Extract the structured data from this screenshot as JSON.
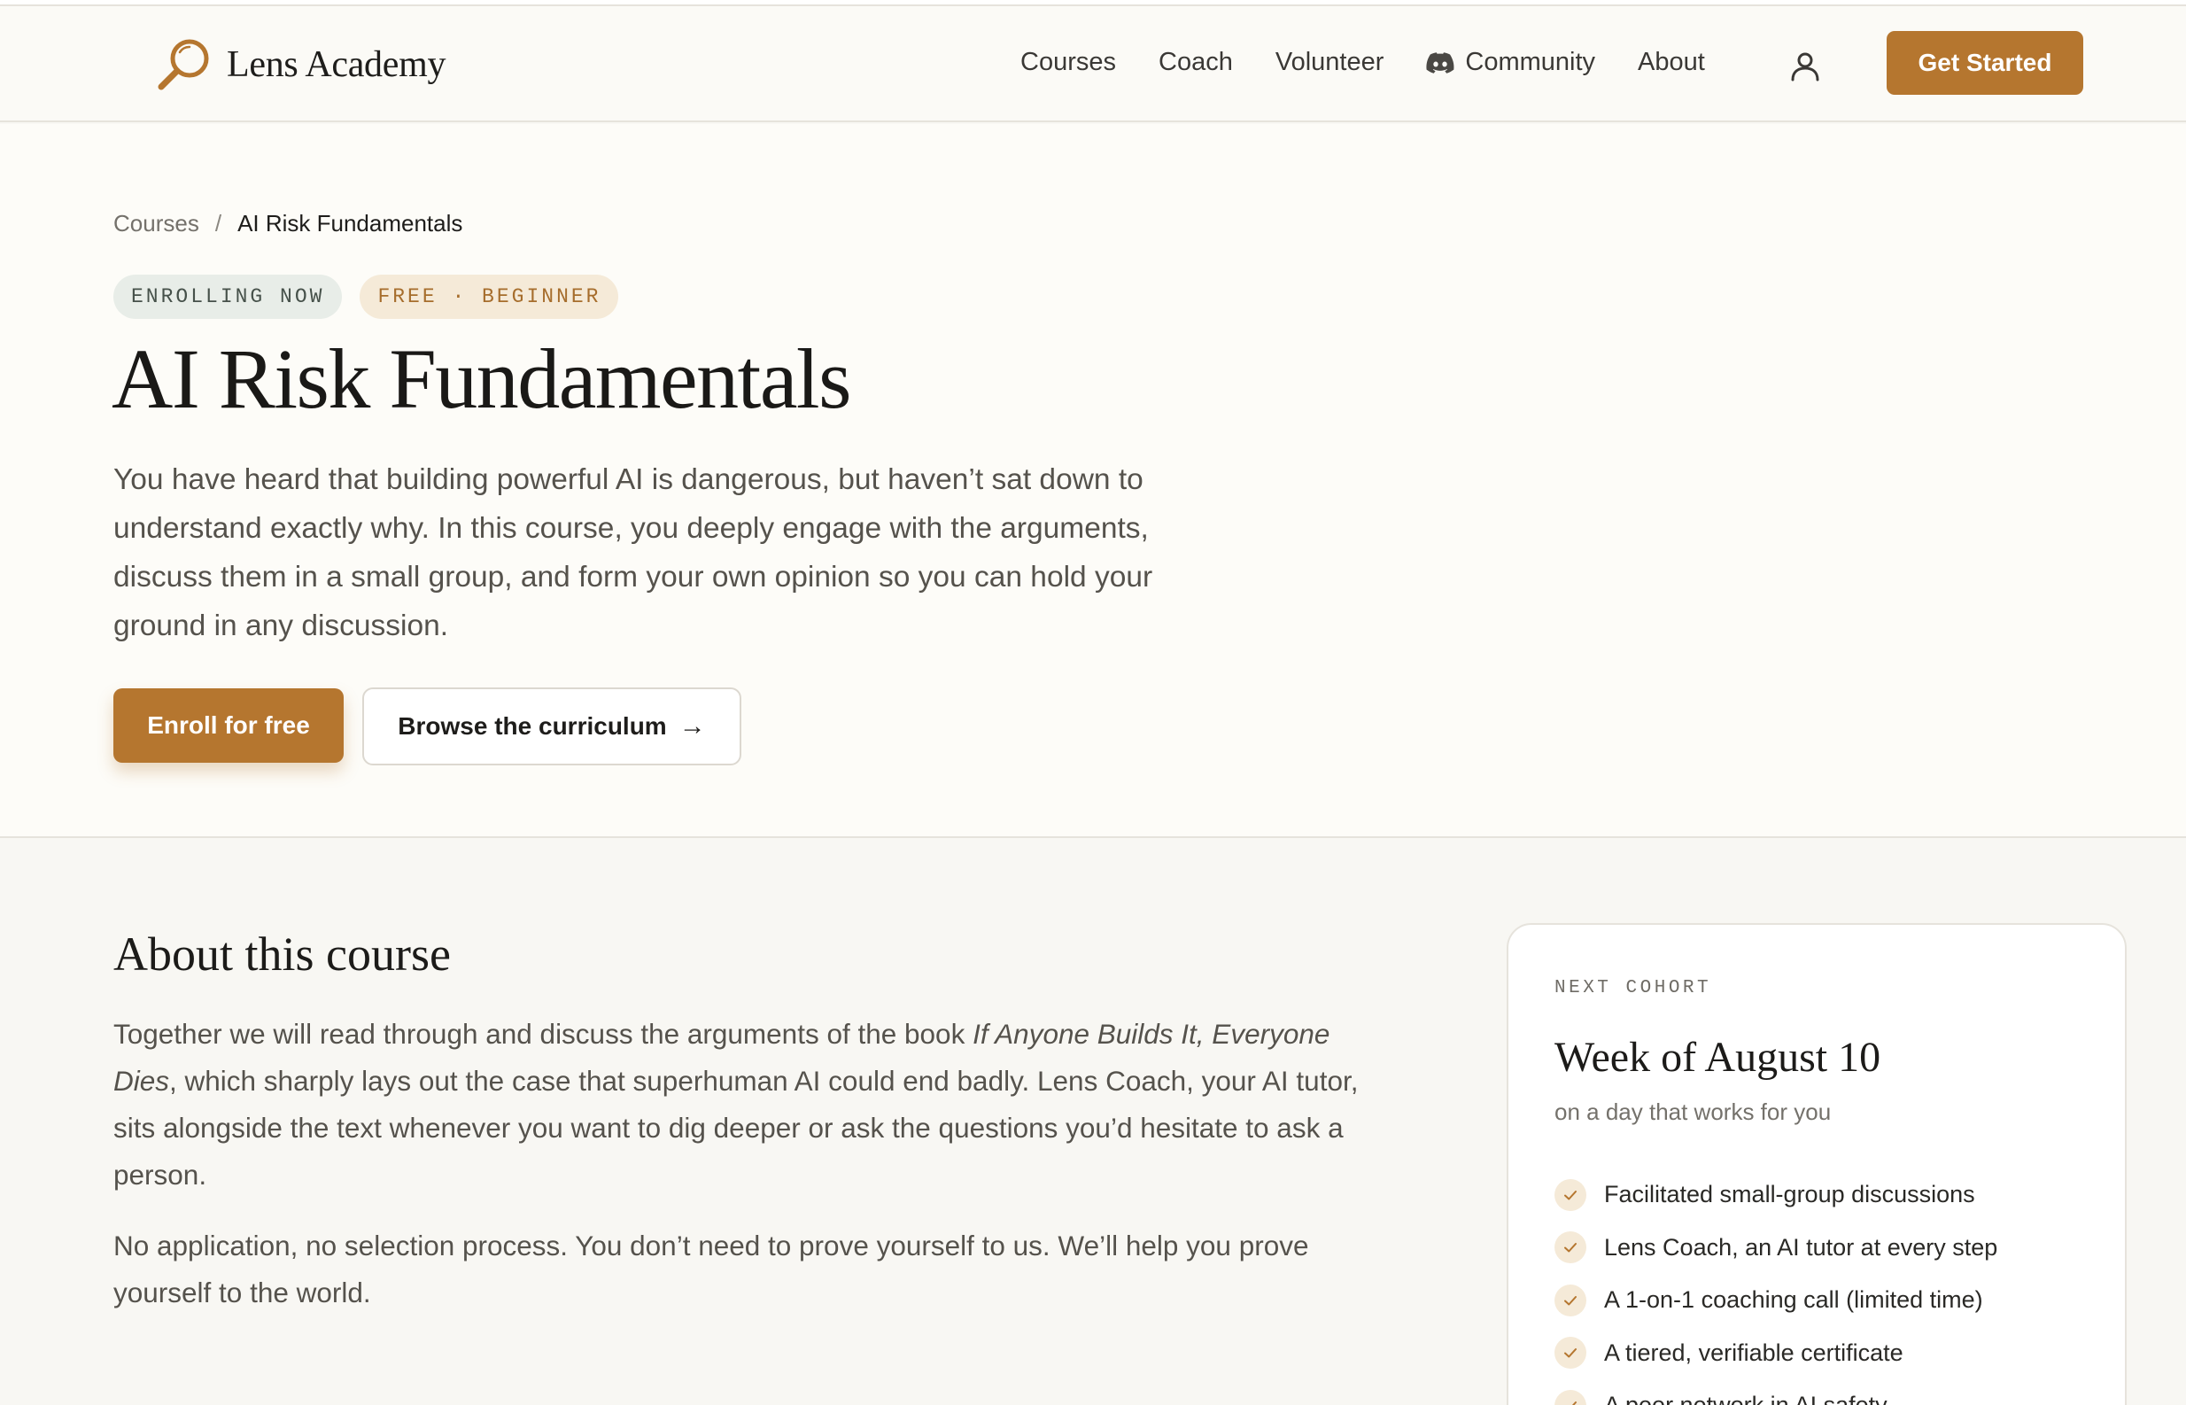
{
  "brand": {
    "name": "Lens Academy",
    "logo_icon": "magnifying-glass-icon",
    "accent_color": "#b5762f"
  },
  "nav": {
    "items": [
      {
        "label": "Courses"
      },
      {
        "label": "Coach"
      },
      {
        "label": "Volunteer"
      },
      {
        "label": "Community",
        "icon": "discord-icon"
      },
      {
        "label": "About"
      }
    ],
    "user_icon": "user-icon",
    "cta_label": "Get Started"
  },
  "breadcrumb": {
    "parent": "Courses",
    "separator": "/",
    "current": "AI Risk Fundamentals"
  },
  "hero": {
    "badges": [
      "ENROLLING NOW",
      "FREE · BEGINNER"
    ],
    "title": "AI Risk Fundamentals",
    "description": "You have heard that building powerful AI is dangerous, but haven’t sat down to understand exactly why. In this course, you deeply engage with the arguments, discuss them in a small group, and form your own opinion so you can hold your ground in any discussion.",
    "primary_button": "Enroll for free",
    "secondary_button": "Browse the curriculum",
    "secondary_button_arrow": "→"
  },
  "about": {
    "title": "About this course",
    "p1_before": "Together we will read through and discuss the arguments of the book ",
    "p1_book": "If Anyone Builds It, Everyone Dies",
    "p1_after": ", which sharply lays out the case that superhuman AI could end badly. Lens Coach, your AI tutor, sits alongside the text whenever you want to dig deeper or ask the questions you’d hesitate to ask a person.",
    "p2": "No application, no selection process. You don’t need to prove yourself to us. We’ll help you prove yourself to the world."
  },
  "cohort": {
    "eyebrow": "NEXT COHORT",
    "title": "Week of August 10",
    "subtitle": "on a day that works for you",
    "features": [
      "Facilitated small-group discussions",
      "Lens Coach, an AI tutor at every step",
      "A 1-on-1 coaching call (limited time)",
      "A tiered, verifiable certificate",
      "A peer network in AI safety"
    ]
  }
}
